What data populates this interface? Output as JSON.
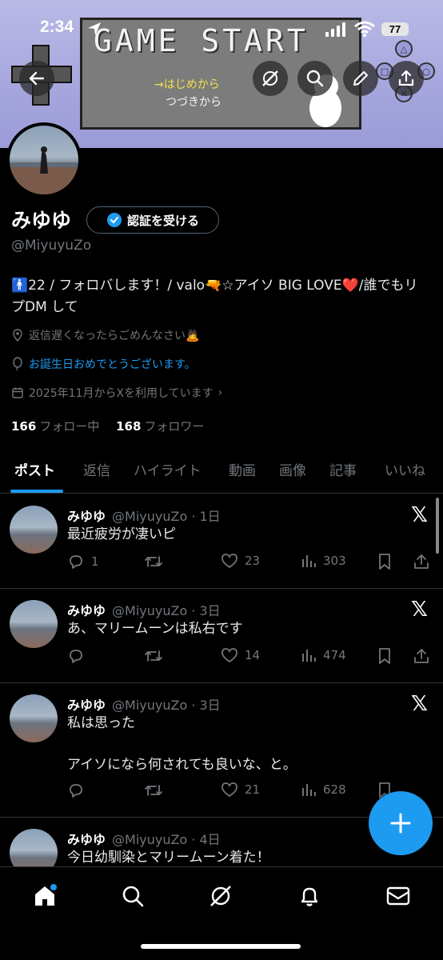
{
  "status_bar": {
    "time": "2:34",
    "battery": "77"
  },
  "banner": {
    "game_title": "GAME START",
    "menu_1": "→はじめから",
    "menu_2": "つづきから"
  },
  "profile": {
    "name": "みゆゆ",
    "verify_label": "認証を受ける",
    "handle": "@MiyuyuZo",
    "bio": "🚹22 / フォロバします！/ valo🔫☆アイソ BIG LOVE❤️/誰でもリプDM して",
    "location": "返信遅くなったらごめんなさい🙇",
    "birthday": "お誕生日おめでとうございます。",
    "joined": "2025年11月からXを利用しています",
    "following_count": "166",
    "following_label": "フォロー中",
    "followers_count": "168",
    "followers_label": "フォロワー"
  },
  "tabs": [
    "ポスト",
    "返信",
    "ハイライト",
    "動画",
    "画像",
    "記事",
    "いいね"
  ],
  "tweets": [
    {
      "name": "みゆゆ",
      "handle_time": "@MiyuyuZo · 1日",
      "text": "最近疲労が凄いピ",
      "replies": "1",
      "likes": "23",
      "views": "303"
    },
    {
      "name": "みゆゆ",
      "handle_time": "@MiyuyuZo · 3日",
      "text": "あ、マリームーンは私右です",
      "replies": "",
      "likes": "14",
      "views": "474"
    },
    {
      "name": "みゆゆ",
      "handle_time": "@MiyuyuZo · 3日",
      "text": "私は思った\n\nアイソになら何されても良いな、と。",
      "replies": "",
      "likes": "21",
      "views": "628"
    },
    {
      "name": "みゆゆ",
      "handle_time": "@MiyuyuZo · 4日",
      "text": "今日幼馴染とマリームーン着た！"
    }
  ],
  "colors": {
    "accent": "#1d9bf0",
    "background": "#000000",
    "muted": "#71767b",
    "text": "#e7e9ea"
  },
  "icons": [
    "back-arrow-icon",
    "grok-icon",
    "search-icon",
    "edit-pen-icon",
    "share-icon",
    "verified-badge-icon",
    "location-pin-icon",
    "balloon-icon",
    "calendar-icon",
    "reply-icon",
    "retweet-icon",
    "like-icon",
    "views-icon",
    "bookmark-icon",
    "x-logo-icon",
    "compose-plus-icon",
    "home-icon",
    "bell-icon",
    "mail-icon"
  ]
}
